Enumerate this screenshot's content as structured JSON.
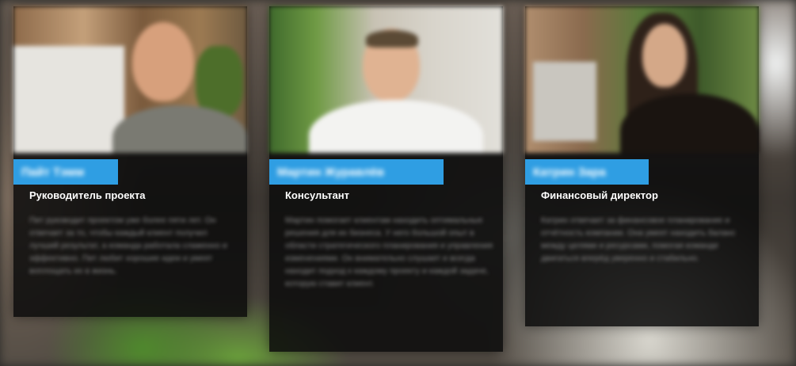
{
  "team": [
    {
      "name": "Пайт Тэмм",
      "role": "Руководитель проекта",
      "description": "Пит руководит проектом уже более пяти лет. Он отвечает за то, чтобы каждый клиент получил лучший результат, а команда работала слаженно и эффективно. Пит любит хорошие идеи и умеет воплощать их в жизнь."
    },
    {
      "name": "Мартин Журавлёв",
      "role": "Консультант",
      "description": "Мартин помогает клиентам находить оптимальные решения для их бизнеса. У него большой опыт в области стратегического планирования и управления изменениями. Он внимательно слушает и всегда находит подход к каждому проекту и каждой задаче, которую ставит клиент."
    },
    {
      "name": "Катрин Зара",
      "role": "Финансовый директор",
      "description": "Катрин отвечает за финансовое планирование и отчётность компании. Она умеет находить баланс между целями и ресурсами, помогая команде двигаться вперёд уверенно и стабильно."
    }
  ],
  "colors": {
    "name_tag": "#2f9ee3",
    "card_bg": "#0c0c0c"
  }
}
